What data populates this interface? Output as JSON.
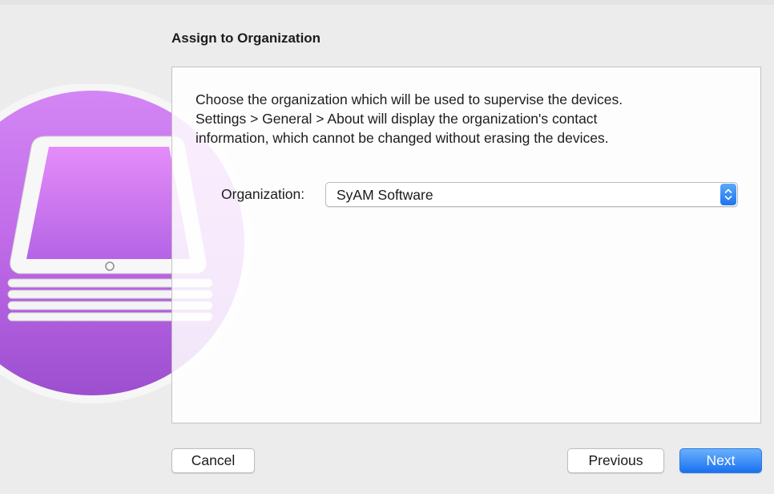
{
  "dialog": {
    "title": "Assign to Organization",
    "description_lines": [
      "Choose the organization which will be used to supervise the devices.",
      "Settings > General > About will display the organization's contact",
      "information, which cannot be changed without erasing the devices."
    ],
    "organization_label": "Organization:",
    "organization_value": "SyAM Software"
  },
  "buttons": {
    "cancel": "Cancel",
    "previous": "Previous",
    "next": "Next"
  },
  "icons": {
    "artwork": "apple-configurator-ipad-stack-icon",
    "popup_arrows": "chevron-up-down-icon"
  },
  "colors": {
    "accent": "#1a71f0",
    "artwork_purple": "#c06ae8",
    "window_bg": "#ececec"
  }
}
